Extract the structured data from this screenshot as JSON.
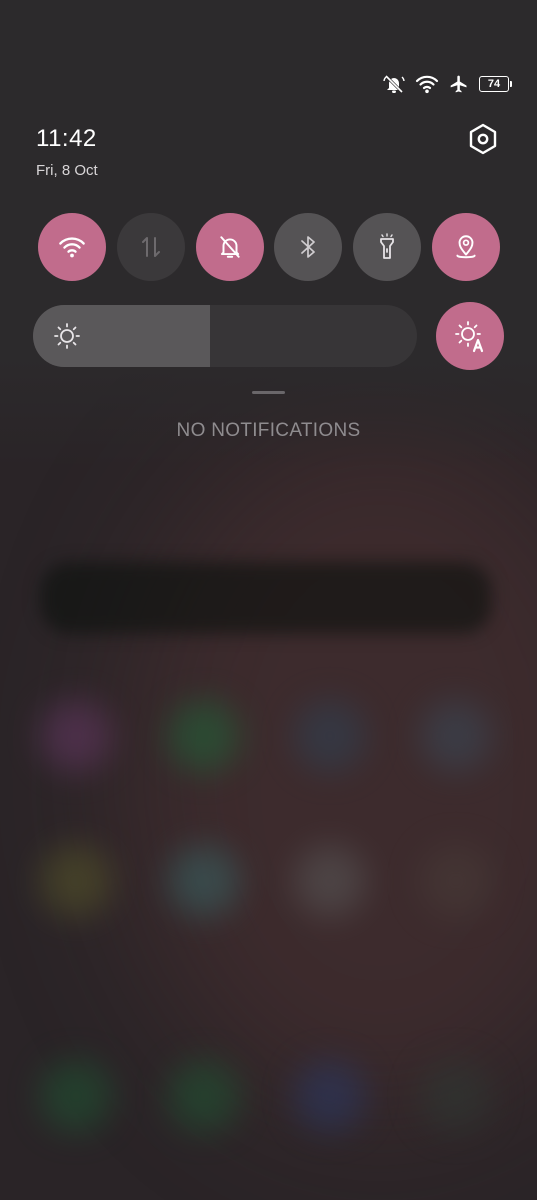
{
  "status_bar": {
    "icons": [
      "bell-muted-icon",
      "wifi-icon",
      "airplane-icon",
      "battery-icon"
    ],
    "battery_level": "74"
  },
  "header": {
    "time": "11:42",
    "date": "Fri, 8 Oct",
    "settings_icon": "settings-hexagon-icon"
  },
  "quick_tiles": [
    {
      "name": "wifi",
      "icon": "wifi-icon",
      "active": true
    },
    {
      "name": "mobile-data",
      "icon": "data-arrows-icon",
      "active": false
    },
    {
      "name": "silent",
      "icon": "bell-off-icon",
      "active": true
    },
    {
      "name": "bluetooth",
      "icon": "bluetooth-icon",
      "active": false
    },
    {
      "name": "flashlight",
      "icon": "flashlight-icon",
      "active": false
    },
    {
      "name": "location",
      "icon": "location-icon",
      "active": true
    }
  ],
  "brightness": {
    "level_percent": 46,
    "auto_icon": "auto-brightness-icon"
  },
  "notifications": {
    "empty_text": "NO NOTIFICATIONS"
  },
  "colors": {
    "accent": "#c16c8c",
    "tile_off": "#555355",
    "panel_bg": "#2c2a2c"
  }
}
